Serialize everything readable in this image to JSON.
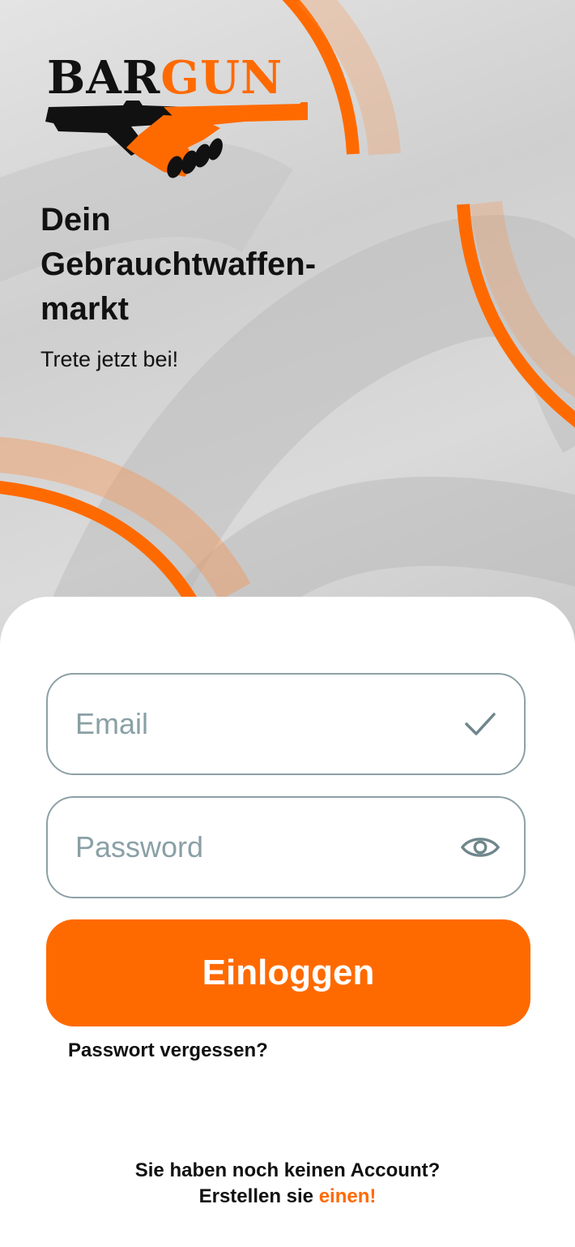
{
  "brand": {
    "logo_part1": "BAR",
    "logo_part2": "GUN",
    "accent_color": "#ff6a00",
    "logo_icon": "handshake-gun-icon"
  },
  "hero": {
    "headline_line1": "Dein",
    "headline_line2": "Gebrauchtwaffen-",
    "headline_line3": "markt",
    "subline": "Trete jetzt bei!"
  },
  "form": {
    "email_placeholder": "Email",
    "email_icon": "checkmark-icon",
    "password_placeholder": "Password",
    "password_icon": "eye-icon",
    "login_label": "Einloggen",
    "forgot_label": "Passwort vergessen?"
  },
  "signup": {
    "prompt": "Sie haben noch keinen Account?",
    "cta_prefix": "Erstellen sie",
    "cta_link": "einen!"
  },
  "colors": {
    "field_border": "#8da1a6",
    "placeholder": "#8aa0a6"
  }
}
